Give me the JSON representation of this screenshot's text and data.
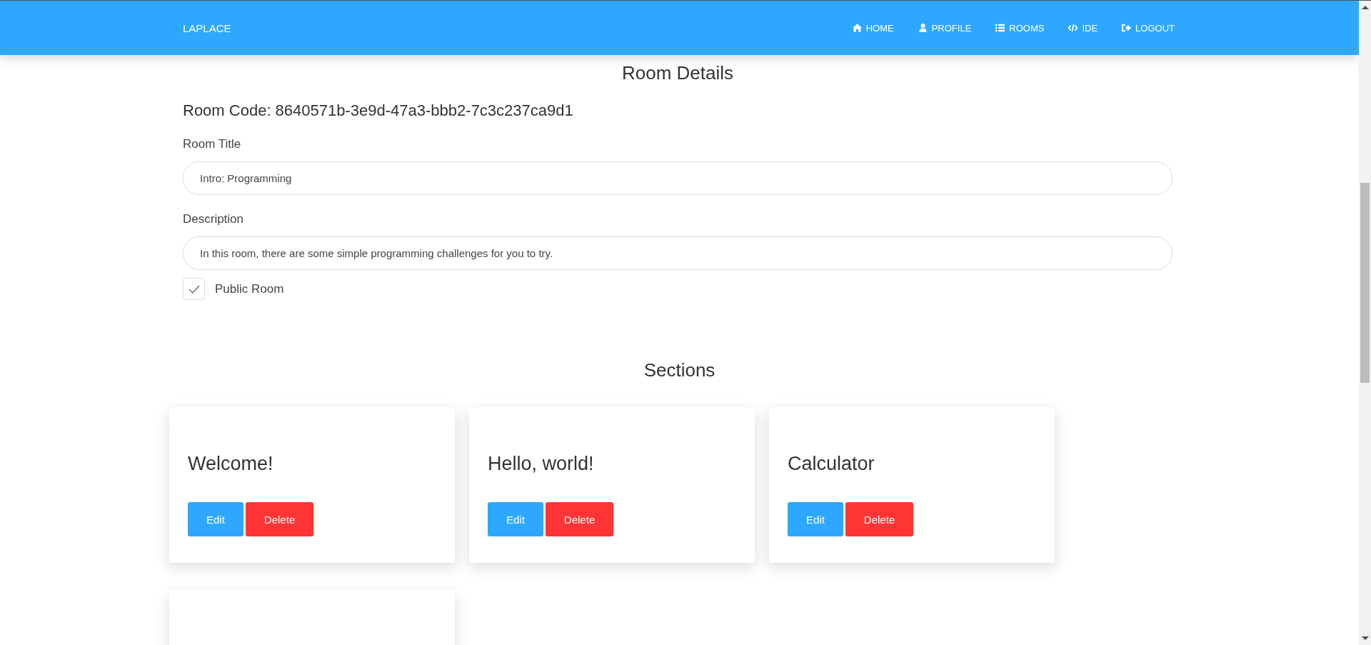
{
  "navbar": {
    "brand": "LAPLACE",
    "links": [
      {
        "kind": "home",
        "label": "HOME"
      },
      {
        "kind": "profile",
        "label": "PROFILE"
      },
      {
        "kind": "rooms",
        "label": "ROOMS"
      },
      {
        "kind": "ide",
        "label": "IDE"
      },
      {
        "kind": "logout",
        "label": "LOGOUT"
      }
    ]
  },
  "room": {
    "heading": "Room Details",
    "code": "Room Code: 8640571b-3e9d-47a3-bbb2-7c3c237ca9d1",
    "title_label": "Room Title",
    "title_value": "Intro: Programming",
    "description_label": "Description",
    "description_value": "In this room, there are some simple programming challenges for you to try.",
    "public": {
      "label": "Public Room",
      "checked": true
    }
  },
  "sections": {
    "heading": "Sections",
    "cards": [
      {
        "title": "Welcome!",
        "buttons": [
          "Edit",
          "Delete"
        ]
      },
      {
        "title": "Hello, world!",
        "buttons": [
          "Edit",
          "Delete"
        ]
      },
      {
        "title": "Calculator",
        "buttons": [
          "Edit",
          "Delete"
        ]
      }
    ],
    "partial_card_below": true
  }
}
